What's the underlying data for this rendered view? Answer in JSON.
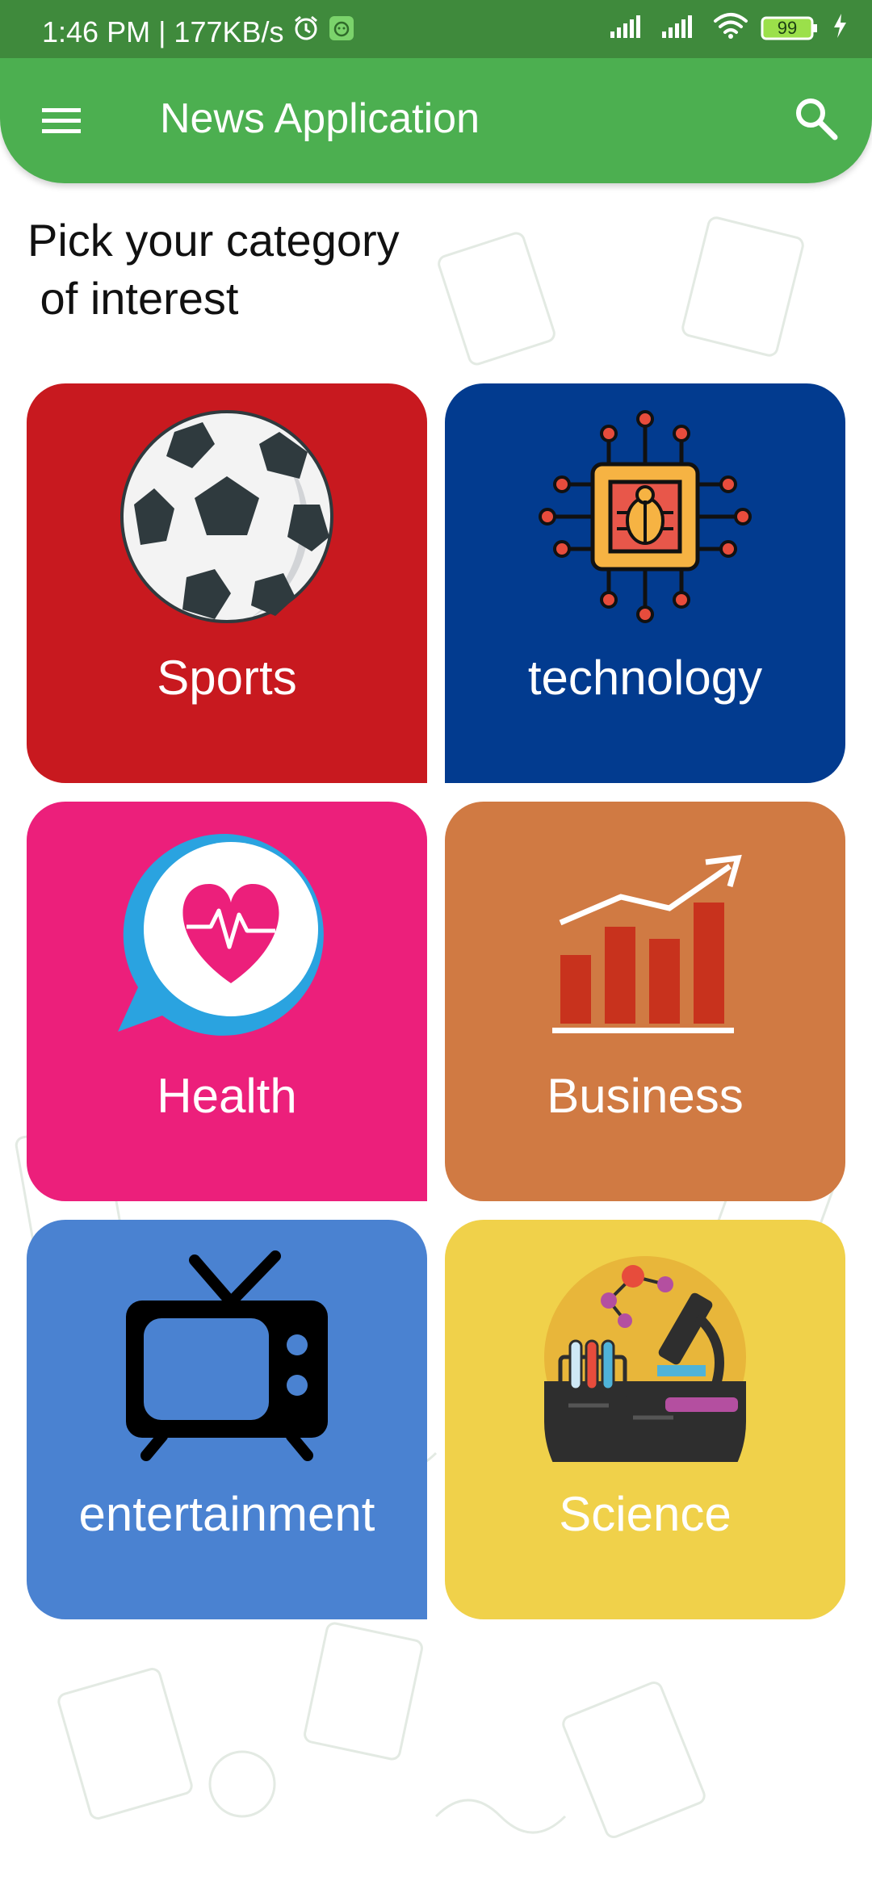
{
  "status": {
    "time_speed": "1:46 PM | 177KB/s",
    "battery": "99"
  },
  "app_bar": {
    "title": "News Application",
    "menu_icon": "hamburger-menu-icon",
    "search_icon": "search-icon",
    "color": "#4caf50"
  },
  "heading": "Pick your category\n of interest",
  "categories": [
    {
      "label": "Sports",
      "color": "#c8191f",
      "icon": "soccer-ball-icon"
    },
    {
      "label": "technology",
      "color": "#023b8f",
      "icon": "chip-bug-icon"
    },
    {
      "label": "Health",
      "color": "#ec1f7b",
      "icon": "heart-chat-icon"
    },
    {
      "label": "Business",
      "color": "#d07a43",
      "icon": "bar-chart-growth-icon"
    },
    {
      "label": "entertainment",
      "color": "#4a82d1",
      "icon": "tv-icon"
    },
    {
      "label": "Science",
      "color": "#f0d14a",
      "icon": "science-lab-icon"
    }
  ]
}
